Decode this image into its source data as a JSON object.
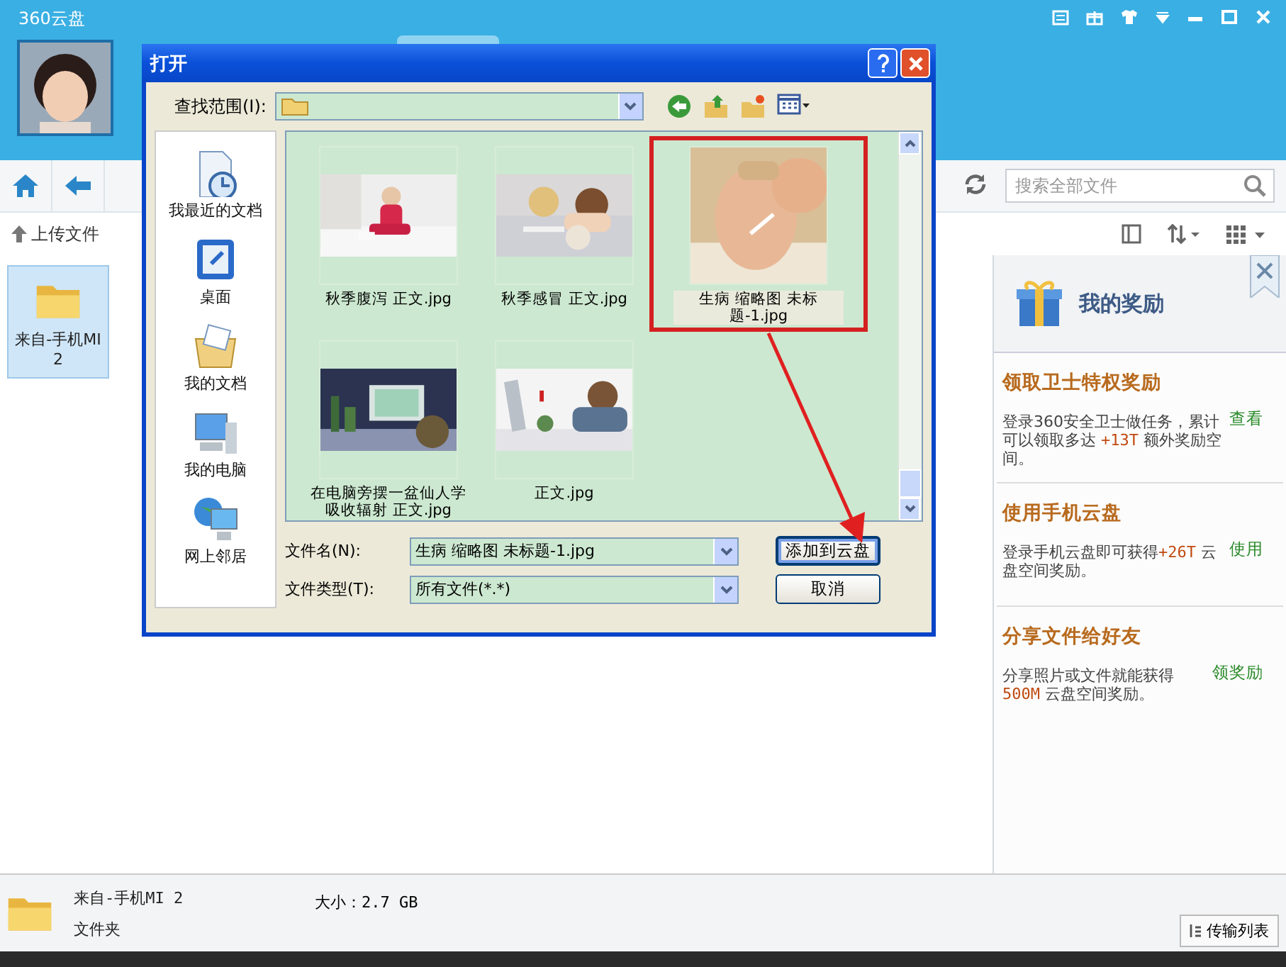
{
  "app": {
    "title": "360云盘"
  },
  "toolbar": {
    "search": {
      "placeholder": "搜索全部文件"
    },
    "upload": "上传文件"
  },
  "files": [
    {
      "name": "来自-手机MI 2",
      "selected": true
    }
  ],
  "dialog": {
    "title": "打开",
    "look_in_label": "查找范围(I):",
    "places": [
      {
        "label": "我最近的文档"
      },
      {
        "label": "桌面"
      },
      {
        "label": "我的文档"
      },
      {
        "label": "我的电脑"
      },
      {
        "label": "网上邻居"
      }
    ],
    "files": [
      {
        "name": "秋季腹泻 正文.jpg",
        "selected": false
      },
      {
        "name": "秋季感冒 正文.jpg",
        "selected": false
      },
      {
        "name": "生病 缩略图 未标题-1.jpg",
        "selected": true
      },
      {
        "name": "在电脑旁摆一盆仙人学吸收辐射 正文.jpg",
        "selected": false
      },
      {
        "name": "正文.jpg",
        "selected": false
      }
    ],
    "filename_label": "文件名(N):",
    "filename": "生病 缩略图 未标题-1.jpg",
    "filetype_label": "文件类型(T):",
    "filetype": "所有文件(*.*)",
    "buttons": [
      {
        "label": "添加到云盘",
        "default": true
      },
      {
        "label": "取消",
        "default": false
      }
    ]
  },
  "rewards": {
    "title": "我的奖励",
    "items": [
      {
        "title": "领取卫士特权奖励",
        "action": "查看",
        "desc": [
          {
            "text": "登录360安全卫士做任务，累计可以领取多达 ",
            "highlight": false
          },
          {
            "text": "+13T",
            "highlight": true
          },
          {
            "text": " 额外奖励空间。",
            "highlight": false
          }
        ]
      },
      {
        "title": "使用手机云盘",
        "action": "使用",
        "desc": [
          {
            "text": "登录手机云盘即可获得",
            "highlight": false
          },
          {
            "text": "+26T",
            "highlight": true
          },
          {
            "text": " 云盘空间奖励。",
            "highlight": false
          }
        ]
      },
      {
        "title": "分享文件给好友",
        "action": "领奖励",
        "desc": [
          {
            "text": "分享照片或文件就能获得",
            "highlight": false
          },
          {
            "text": "500M",
            "highlight": true
          },
          {
            "text": " 云盘空间奖励。",
            "highlight": false
          }
        ]
      }
    ]
  },
  "status": {
    "name": "来自-手机MI 2",
    "type": "文件夹",
    "size": "大小：2.7 GB",
    "transfer_button": "传输列表"
  }
}
